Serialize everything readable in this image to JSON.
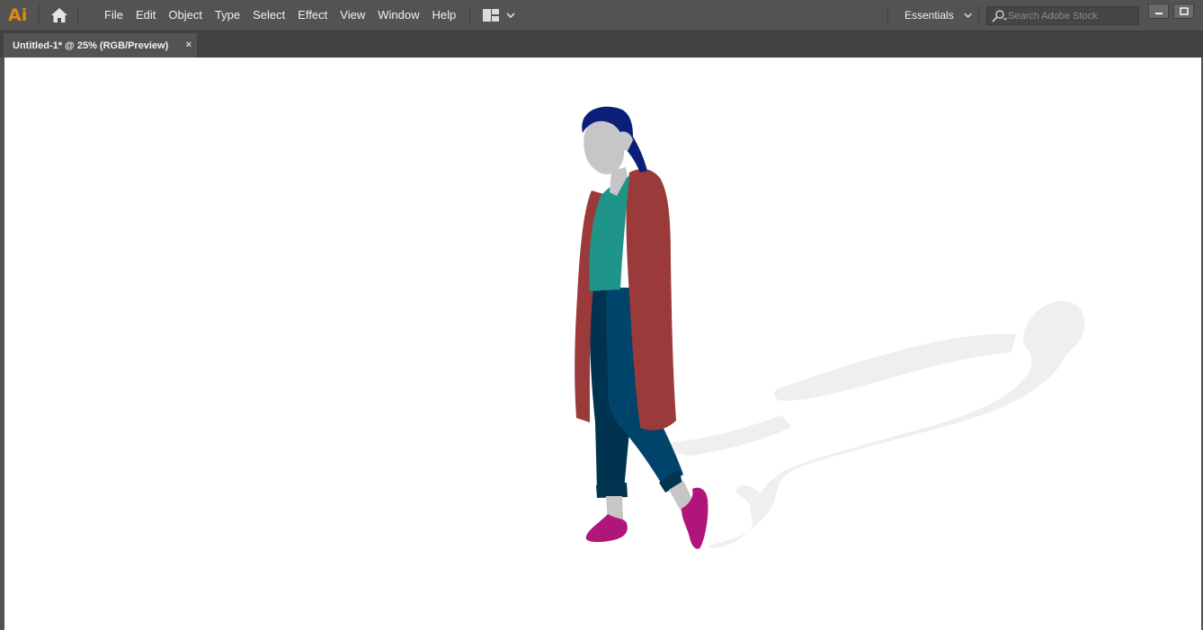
{
  "app": {
    "logo_text": "Ai",
    "brand_color": "#ff9a00"
  },
  "menubar": {
    "items": [
      "File",
      "Edit",
      "Object",
      "Type",
      "Select",
      "Effect",
      "View",
      "Window",
      "Help"
    ],
    "workspace_label": "Essentials",
    "search_placeholder": "Search Adobe Stock"
  },
  "document": {
    "tab_title": "Untitled-1* @ 25% (RGB/Preview)",
    "close_glyph": "×"
  },
  "artwork": {
    "colors": {
      "hair": "#0b1f7a",
      "skin": "#c6c6c6",
      "coat": "#9a3a3a",
      "top": "#1f9488",
      "jeans": "#00446b",
      "jeans_dark": "#003350",
      "shoes": "#b0167a",
      "shadow": "#efefef"
    }
  }
}
